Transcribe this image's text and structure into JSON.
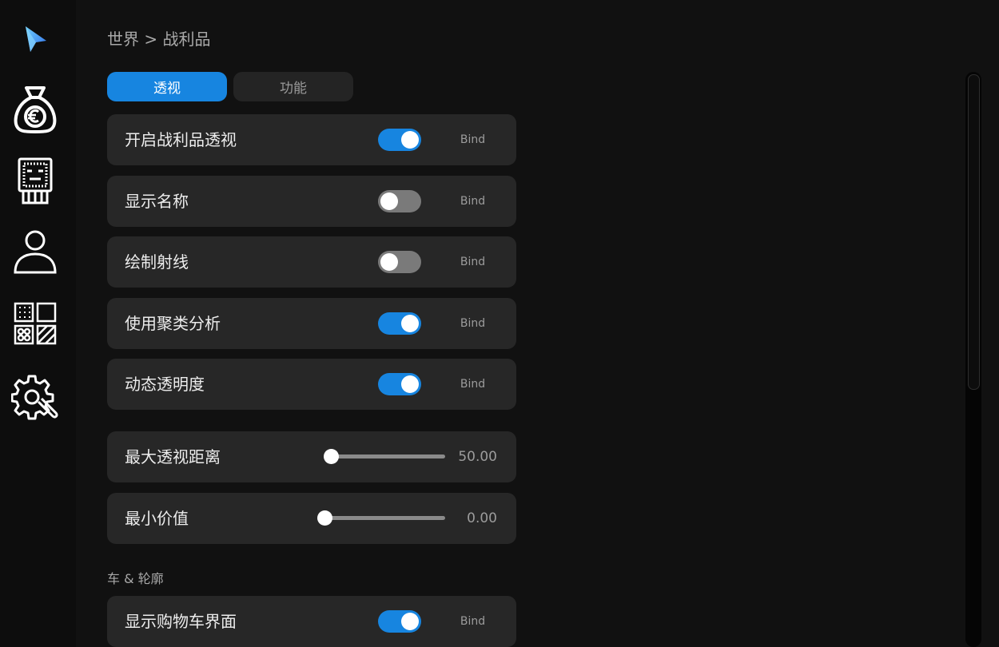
{
  "breadcrumb": "世界 > 战利品",
  "tabs": [
    {
      "label": "透视",
      "active": true
    },
    {
      "label": "功能",
      "active": false
    }
  ],
  "toggles": [
    {
      "label": "开启战利品透视",
      "on": true,
      "bind_label": "Bind"
    },
    {
      "label": "显示名称",
      "on": false,
      "bind_label": "Bind"
    },
    {
      "label": "绘制射线",
      "on": false,
      "bind_label": "Bind"
    },
    {
      "label": "使用聚类分析",
      "on": true,
      "bind_label": "Bind"
    },
    {
      "label": "动态透明度",
      "on": true,
      "bind_label": "Bind"
    }
  ],
  "sliders": [
    {
      "label": "最大透视距离",
      "value": "50.00"
    },
    {
      "label": "最小价值",
      "value": "0.00"
    }
  ],
  "section": {
    "title": "车 & 轮廓",
    "toggles": [
      {
        "label": "显示购物车界面",
        "on": true,
        "bind_label": "Bind"
      }
    ]
  },
  "colors": {
    "accent": "#1785e0",
    "background": "#111111",
    "card": "#272727"
  },
  "sidebar_icons": [
    "logo-arrow-icon",
    "money-bag-icon",
    "chip-icon",
    "user-icon",
    "grid-pattern-icon",
    "gear-wrench-icon"
  ]
}
